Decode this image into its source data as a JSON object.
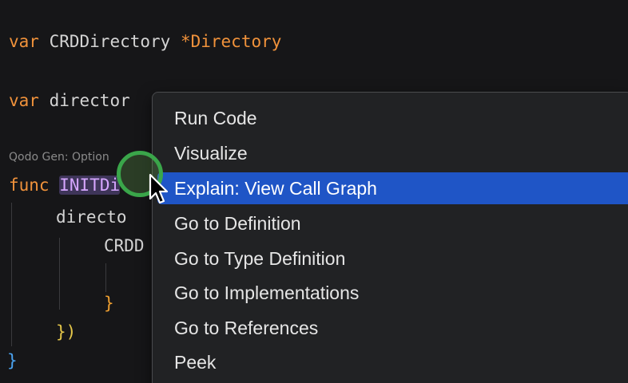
{
  "editor": {
    "line1": {
      "keyword": "var",
      "name": "CRDDirectory",
      "type": "*Directory"
    },
    "line2": {
      "keyword": "var",
      "name": "director"
    },
    "codelens": "Qodo Gen: Option",
    "line3": {
      "keyword": "func",
      "name": "INIT",
      "tail": "Di"
    },
    "line4": {
      "text": "directo"
    },
    "line5": {
      "text": "CRDD"
    },
    "line6": {
      "text": "}"
    },
    "line7": {
      "text": "})"
    },
    "line8": {
      "text": "}"
    }
  },
  "context_menu": {
    "items": [
      {
        "label": "Run Code"
      },
      {
        "label": "Visualize"
      },
      {
        "label": "Explain: View Call Graph",
        "selected": true
      },
      {
        "label": "Go to Definition"
      },
      {
        "label": "Go to Type Definition"
      },
      {
        "label": "Go to Implementations"
      },
      {
        "label": "Go to References"
      },
      {
        "label": "Peek"
      }
    ]
  },
  "colors": {
    "background": "#161618",
    "menu_background": "#212224",
    "selection": "#1f55c6",
    "keyword": "#f0923b",
    "function_name": "#d6a6ff",
    "cursor_highlight": "#3aa64a"
  }
}
